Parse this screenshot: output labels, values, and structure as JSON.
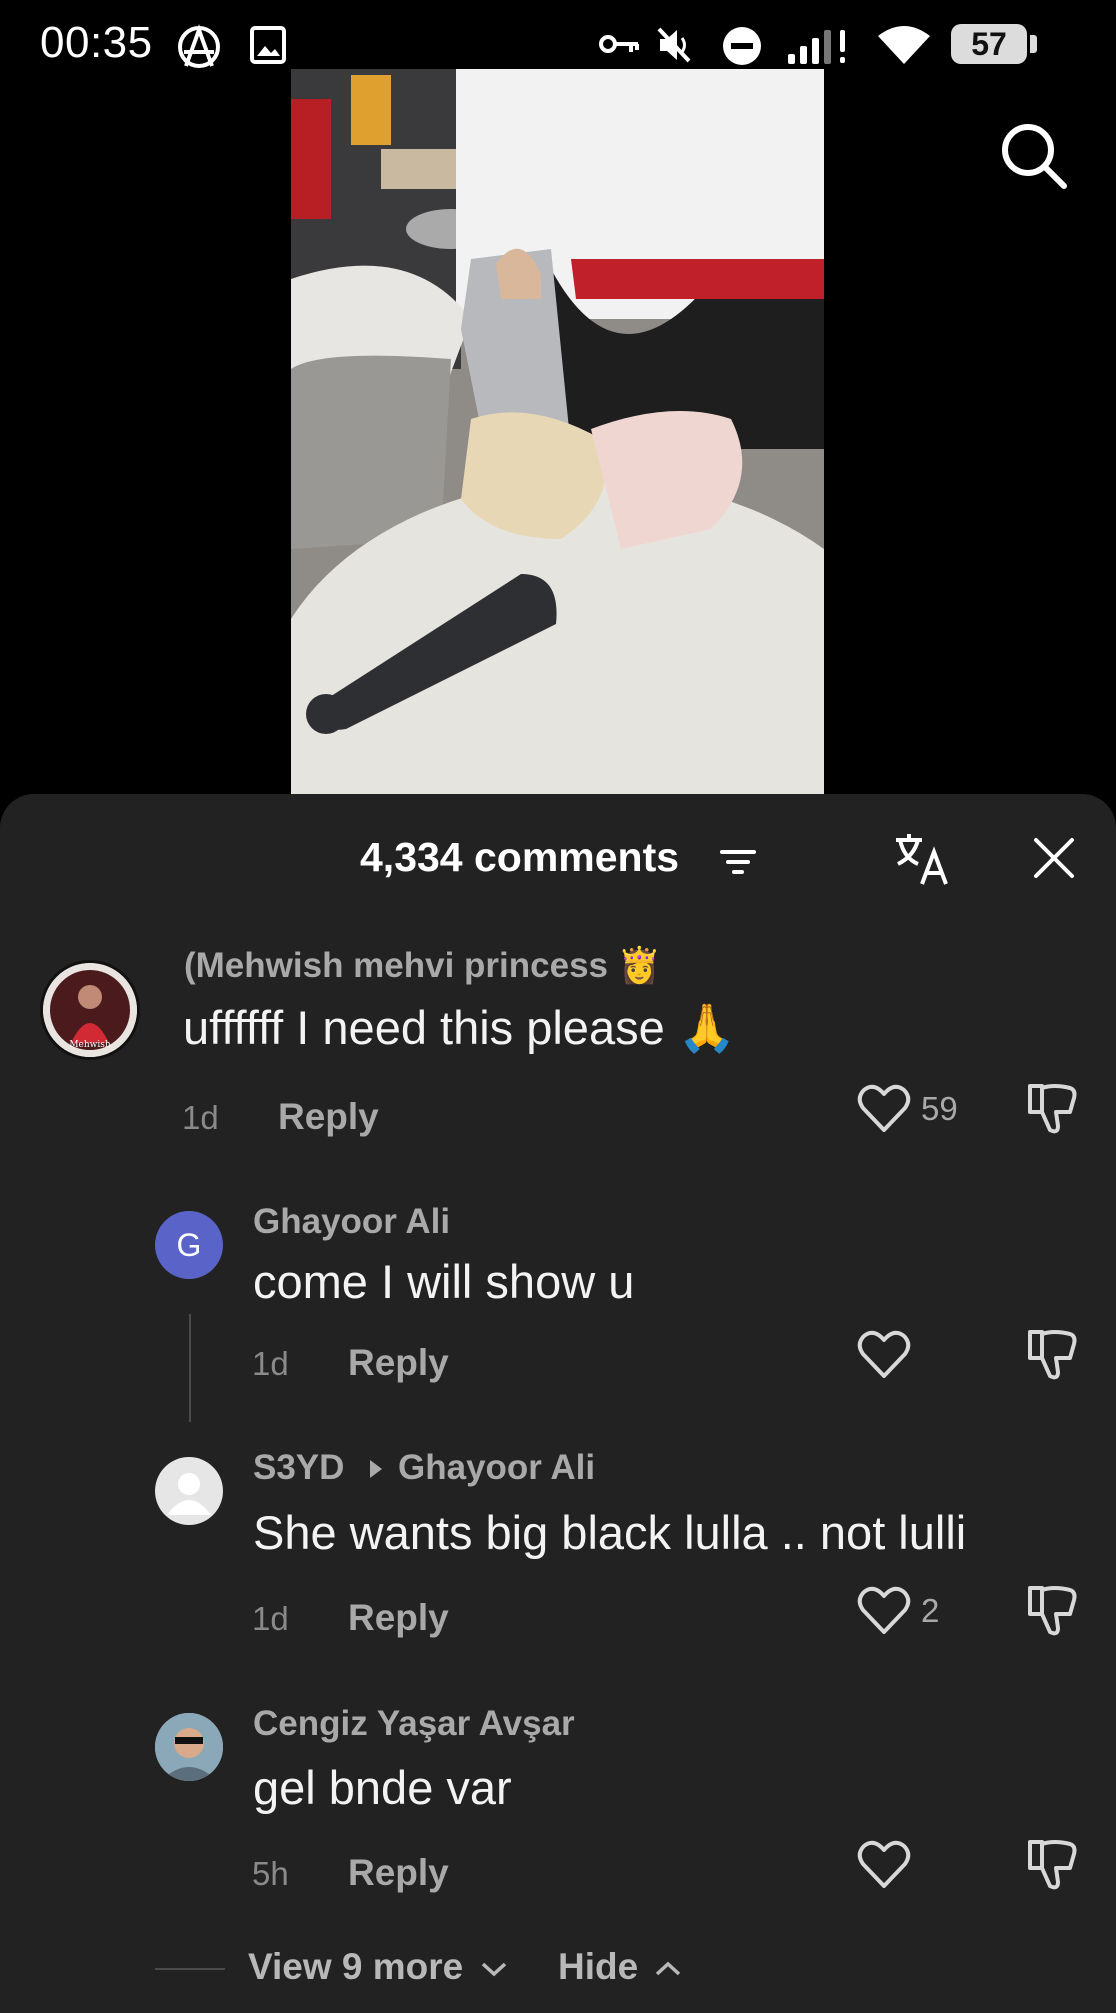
{
  "status_bar": {
    "time": "00:35",
    "battery": "57",
    "icons": [
      "anarchy-icon",
      "gallery-icon",
      "vpn-key-icon",
      "mute-icon",
      "do-not-disturb-icon",
      "signal-icon",
      "wifi-icon",
      "battery-icon"
    ]
  },
  "video": {
    "icons": [
      "search-icon"
    ]
  },
  "comments": {
    "title": "4,334 comments",
    "icons": [
      "filter-icon",
      "translate-icon",
      "close-icon"
    ],
    "items": [
      {
        "user": "(Mehwish mehvi  princess 👸",
        "text": "uffffff I need this please 🙏",
        "time": "1d",
        "reply_label": "Reply",
        "likes": "59",
        "avatar_caption": "Mehwish"
      },
      {
        "user": "Ghayoor Ali",
        "avatar_letter": "G",
        "text": "come I will show u",
        "time": "1d",
        "reply_label": "Reply",
        "likes": ""
      },
      {
        "user": "S3YD",
        "reply_to": "Ghayoor Ali",
        "text": "She wants big black lulla .. not lulli",
        "time": "1d",
        "reply_label": "Reply",
        "likes": "2"
      },
      {
        "user": "Cengiz Yaşar Avşar",
        "text": "gel bnde var",
        "time": "5h",
        "reply_label": "Reply",
        "likes": ""
      }
    ],
    "view_more_label": "View 9 more",
    "hide_label": "Hide"
  },
  "colors": {
    "sheet_bg": "#222223",
    "avatar_g": "#5a64c8"
  }
}
